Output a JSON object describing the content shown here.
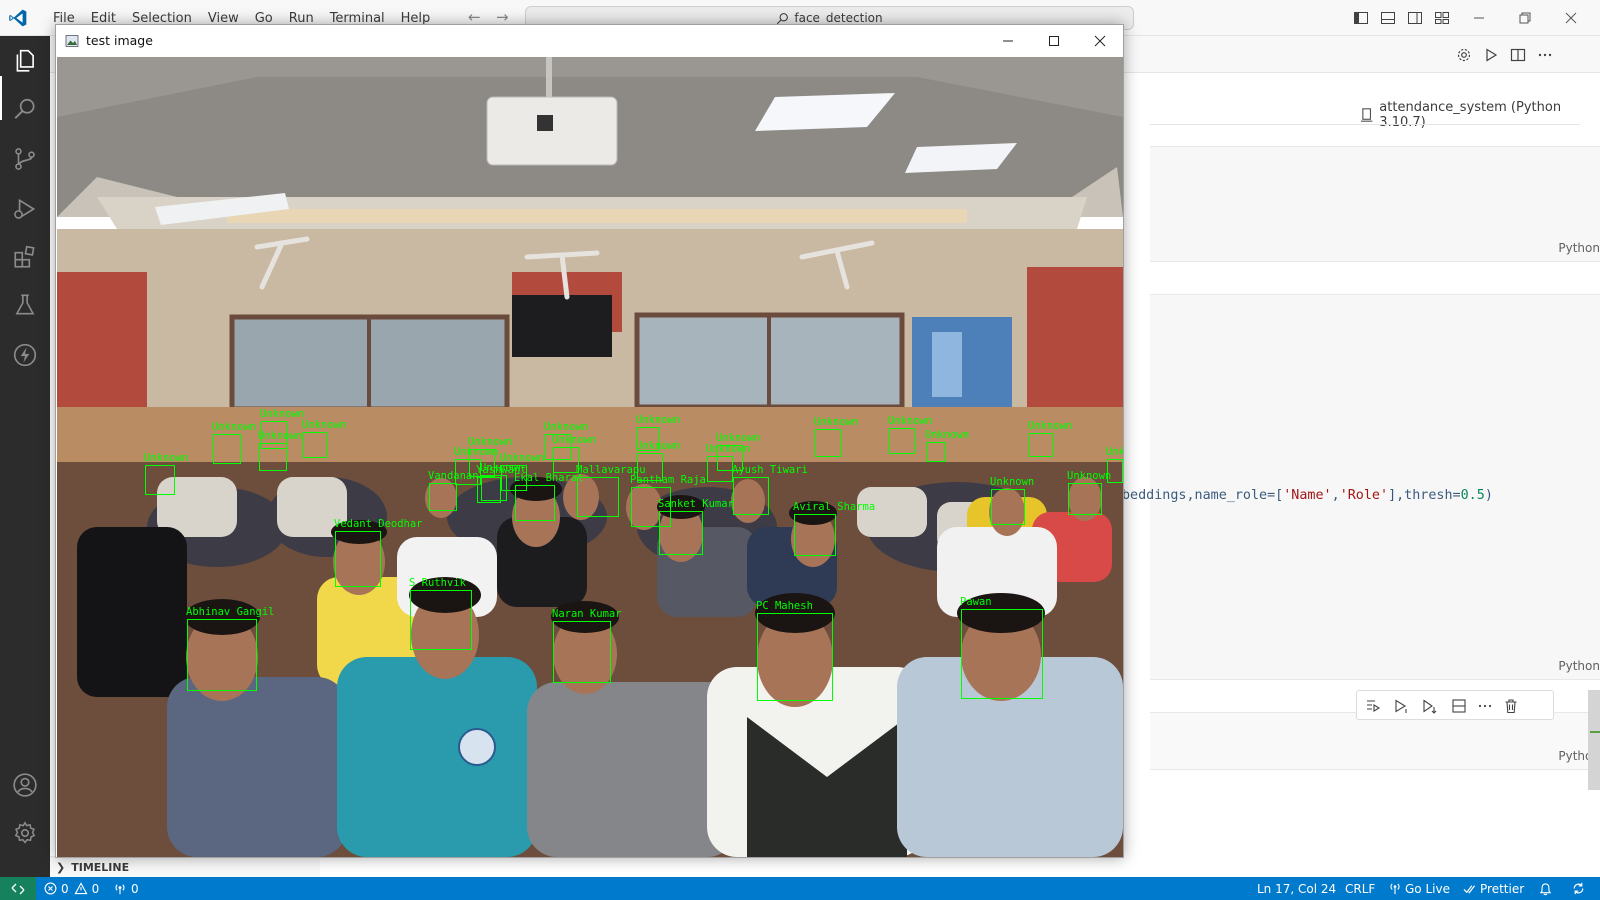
{
  "titlebar": {
    "menu": [
      "File",
      "Edit",
      "Selection",
      "View",
      "Go",
      "Run",
      "Terminal",
      "Help"
    ],
    "search_text": "face_detection"
  },
  "editor": {
    "kernel_label": "attendance_system (Python 3.10.7)",
    "cell_language": "Python",
    "code_tokens": [
      {
        "t": "beddings,name_role=[",
        "c": "plain"
      },
      {
        "t": "'Name'",
        "c": "str"
      },
      {
        "t": ",",
        "c": "plain"
      },
      {
        "t": "'Role'",
        "c": "str"
      },
      {
        "t": "],thresh=",
        "c": "plain"
      },
      {
        "t": "0.5",
        "c": "num"
      },
      {
        "t": ")",
        "c": "plain"
      }
    ]
  },
  "panel": {
    "timeline_label": "TIMELINE"
  },
  "statusbar": {
    "errors": "0",
    "warnings": "0",
    "ports": "0",
    "cursor": "Ln 17, Col 24",
    "eol": "CRLF",
    "go_live": "Go Live",
    "prettier": "Prettier"
  },
  "cv_window": {
    "title": "test image",
    "faces": [
      {
        "label": "Unknown"
      },
      {
        "label": "Unknown"
      },
      {
        "label": "Unknown"
      },
      {
        "label": "Unknown"
      },
      {
        "label": "Unknown"
      },
      {
        "label": "Unknown"
      },
      {
        "label": "Unknown"
      },
      {
        "label": "Unknown"
      },
      {
        "label": "Unknown"
      },
      {
        "label": "Unknown"
      },
      {
        "label": "Unknown"
      },
      {
        "label": "Unknown"
      },
      {
        "label": "Unknown"
      },
      {
        "label": "Unknown"
      },
      {
        "label": "Unknown"
      },
      {
        "label": "Unknown"
      },
      {
        "label": "Unknown"
      },
      {
        "label": "Unknown"
      },
      {
        "label": "Unknown"
      },
      {
        "label": "Unknown"
      },
      {
        "label": "Unknown"
      },
      {
        "label": "Unknown"
      },
      {
        "label": "Vandanan"
      },
      {
        "label": "Yashwant"
      },
      {
        "label": "Ekal Bharat"
      },
      {
        "label": "Mallavarapu"
      },
      {
        "label": "Pantham Raja"
      },
      {
        "label": "Ayush Tiwari"
      },
      {
        "label": "Sanket Kumar"
      },
      {
        "label": "Aviral Sharma"
      },
      {
        "label": "Vedant Deodhar"
      },
      {
        "label": "S Ruthvik"
      },
      {
        "label": "Abhinav Gangil"
      },
      {
        "label": "Naran Kumar"
      },
      {
        "label": "PC Mahesh"
      },
      {
        "label": "Pawan"
      }
    ]
  }
}
